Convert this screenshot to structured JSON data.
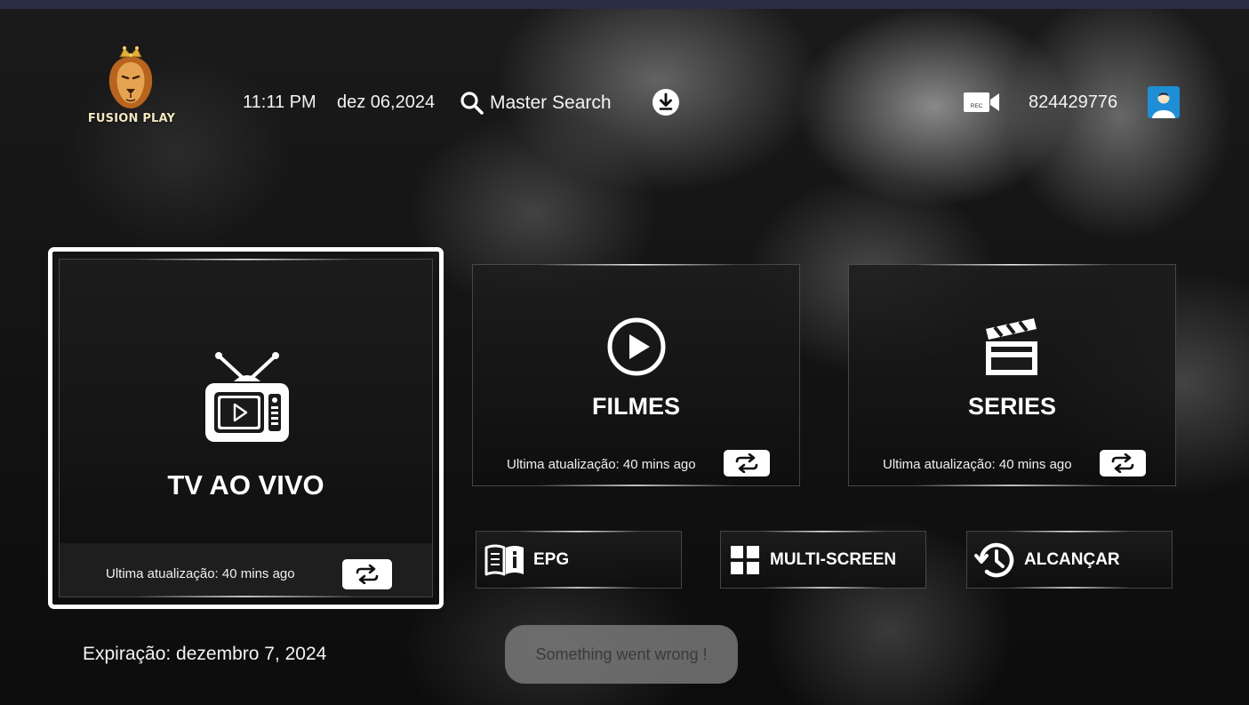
{
  "header": {
    "brand": "FUSION PLAY",
    "time": "11:11 PM",
    "date": "dez 06,2024",
    "search_label": "Master Search",
    "download_icon": "download-icon",
    "record_icon": "rec-camera-icon",
    "rec_badge": "REC",
    "account_number": "824429776",
    "avatar_icon": "user-avatar-icon"
  },
  "tiles": {
    "live": {
      "title": "TV AO VIVO",
      "updated": "Ultima atualização: 40 mins ago",
      "icon": "tv-icon"
    },
    "movies": {
      "title": "FILMES",
      "updated": "Ultima atualização: 40 mins ago",
      "icon": "play-circle-icon"
    },
    "series": {
      "title": "SERIES",
      "updated": "Ultima atualização: 40 mins ago",
      "icon": "clapperboard-icon"
    },
    "epg": {
      "title": "EPG",
      "icon": "book-info-icon"
    },
    "multiscreen": {
      "title": "MULTI-SCREEN",
      "icon": "grid-icon"
    },
    "catchup": {
      "title": "ALCANÇAR",
      "icon": "history-clock-icon"
    }
  },
  "footer": {
    "expiry": "Expiração: dezembro 7, 2024",
    "toast": "Something went wrong !"
  },
  "colors": {
    "top_bar": "#2b2d44",
    "avatar_bg": "#1e8fd6",
    "toast_bg": "#787878"
  }
}
